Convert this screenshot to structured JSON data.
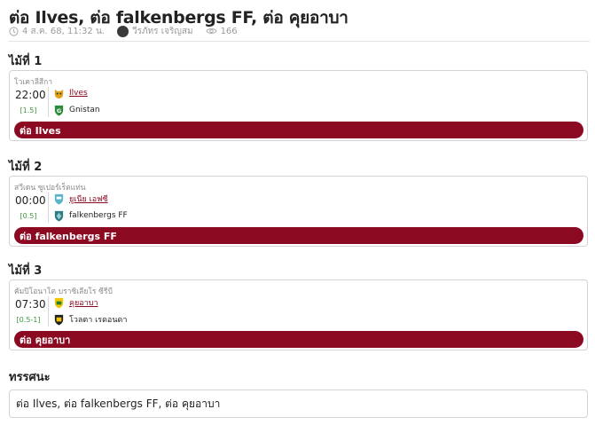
{
  "article": {
    "title": "ต่อ Ilves, ต่อ falkenbergs FF, ต่อ คุยอาบา",
    "date": "4 ส.ค. 68, 11:32 น.",
    "author": "วีรภัทร เจริญสม",
    "views": "166"
  },
  "pairs": [
    {
      "heading": "ไม้ที่ 1",
      "league": "โวเคาลีสีกา",
      "time": "22:00",
      "odds": "[1.5]",
      "team1": "Ilves",
      "team2": "Gnistan",
      "pick": "ต่อ Ilves"
    },
    {
      "heading": "ไม้ที่ 2",
      "league": "สวีเดน ซูเปอร์เร็ตแท่น",
      "time": "00:00",
      "odds": "[0.5]",
      "team1": "ยูเนีย เอฟซี",
      "team2": "falkenbergs FF",
      "pick": "ต่อ falkenbergs FF"
    },
    {
      "heading": "ไม้ที่ 3",
      "league": "คัมปิโอนาโต บราซิเลียโร ซีรีบี",
      "time": "07:30",
      "odds": "[0.5-1]",
      "team1": "คุยอาบา",
      "team2": "โวลตา เรดอนดา",
      "pick": "ต่อ คุยอาบา"
    }
  ],
  "summary": {
    "heading": "ทรรศนะ",
    "text": "ต่อ Ilves, ต่อ falkenbergs FF, ต่อ คุยอาบา"
  },
  "colors": {
    "accent": "#8b0a22",
    "odds_green": "#3a9a3a",
    "meta_gray": "#9a9a9a"
  },
  "icons": [
    "clock-icon",
    "avatar",
    "eye-icon",
    "team-logo"
  ]
}
